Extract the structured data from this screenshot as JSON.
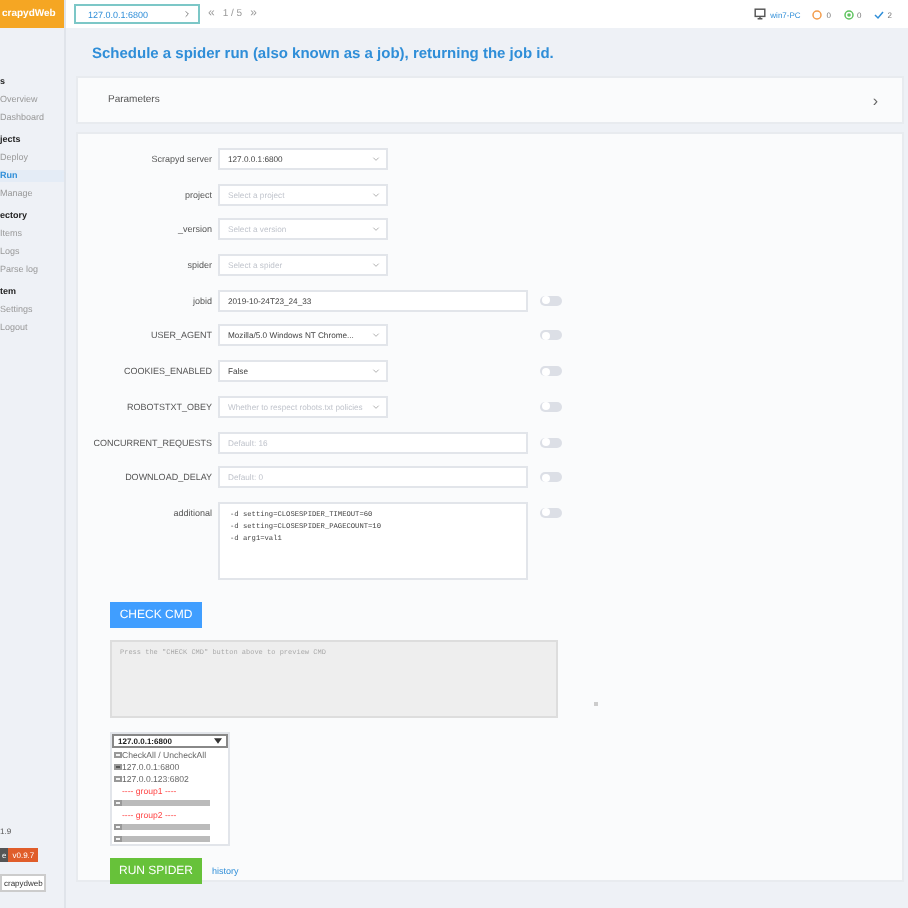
{
  "logo": "crapydWeb",
  "topbar": {
    "server": "127.0.0.1:6800",
    "page": "1 / 5",
    "prev": "«",
    "next": "»",
    "host": "win7-PC",
    "counts": [
      {
        "kind": "pending",
        "value": "0"
      },
      {
        "kind": "running",
        "value": "0"
      },
      {
        "kind": "finished",
        "value": "2"
      }
    ]
  },
  "sidebar": {
    "items": [
      {
        "kind": "section",
        "label": "s"
      },
      {
        "kind": "item",
        "label": "Overview",
        "selected": false
      },
      {
        "kind": "item",
        "label": "Dashboard",
        "selected": false
      },
      {
        "kind": "section",
        "label": "jects"
      },
      {
        "kind": "item",
        "label": "Deploy",
        "selected": false
      },
      {
        "kind": "item",
        "label": "Run",
        "selected": true
      },
      {
        "kind": "item",
        "label": "Manage",
        "selected": false
      },
      {
        "kind": "section",
        "label": "ectory"
      },
      {
        "kind": "item",
        "label": "Items",
        "selected": false
      },
      {
        "kind": "item",
        "label": "Logs",
        "selected": false
      },
      {
        "kind": "item",
        "label": "Parse log",
        "selected": false
      },
      {
        "kind": "section",
        "label": "tem"
      },
      {
        "kind": "item",
        "label": "Settings",
        "selected": false
      },
      {
        "kind": "item",
        "label": "Logout",
        "selected": false
      }
    ],
    "footer": {
      "version": "1.9",
      "badge_left": "e",
      "badge_right": "v0.9.7",
      "project": "crapydweb"
    }
  },
  "title": "Schedule a spider run (also known as a job), returning the job id.",
  "parameters": {
    "label": "Parameters",
    "chevron": "›"
  },
  "form": {
    "rows": [
      {
        "label": "Scrapyd server",
        "kind": "select",
        "value": "127.0.0.1:6800"
      },
      {
        "label": "project",
        "kind": "select",
        "placeholder": "Select a project"
      },
      {
        "label": "_version",
        "kind": "select",
        "placeholder": "Select a version"
      },
      {
        "label": "spider",
        "kind": "select",
        "placeholder": "Select a spider"
      },
      {
        "label": "jobid",
        "kind": "input",
        "value": "2019-10-24T23_24_33",
        "toggle": {
          "on": false
        }
      },
      {
        "label": "USER_AGENT",
        "kind": "select",
        "value": "Mozilla/5.0 Windows NT Chrome...",
        "toggle": {
          "on": false
        }
      },
      {
        "label": "COOKIES_ENABLED",
        "kind": "select",
        "value": "False",
        "toggle": {
          "on": false
        }
      },
      {
        "label": "ROBOTSTXT_OBEY",
        "kind": "select",
        "placeholder": "Whether to respect robots.txt policies",
        "toggle": {
          "on": false
        }
      },
      {
        "label": "CONCURRENT_REQUESTS",
        "kind": "input",
        "placeholder": "Default: 16",
        "toggle": {
          "on": false
        }
      },
      {
        "label": "DOWNLOAD_DELAY",
        "kind": "input",
        "placeholder": "Default: 0",
        "toggle": {
          "on": false
        }
      },
      {
        "label": "additional",
        "kind": "textarea",
        "value": "-d setting=CLOSESPIDER_TIMEOUT=60\n-d setting=CLOSESPIDER_PAGECOUNT=10\n-d arg1=val1",
        "toggle": {
          "on": false
        }
      }
    ],
    "check_button": "CHECK CMD",
    "preview_placeholder": "Press the \"CHECK CMD\" button above to preview CMD",
    "nodes": {
      "select": "127.0.0.1:6800",
      "items": [
        {
          "kind": "checkbox",
          "label": "CheckAll / UncheckAll",
          "checked": false
        },
        {
          "kind": "checkbox",
          "label": "127.0.0.1:6800",
          "checked": true
        },
        {
          "kind": "checkbox",
          "label": "127.0.0.123:6802",
          "checked": false
        },
        {
          "kind": "group",
          "label": "---- group1 ----"
        },
        {
          "kind": "hidden",
          "checked": false
        },
        {
          "kind": "group",
          "label": "---- group2 ----"
        },
        {
          "kind": "hidden",
          "checked": false
        },
        {
          "kind": "hidden",
          "checked": false
        }
      ]
    },
    "run_button": "RUN SPIDER",
    "history_link": "history"
  }
}
